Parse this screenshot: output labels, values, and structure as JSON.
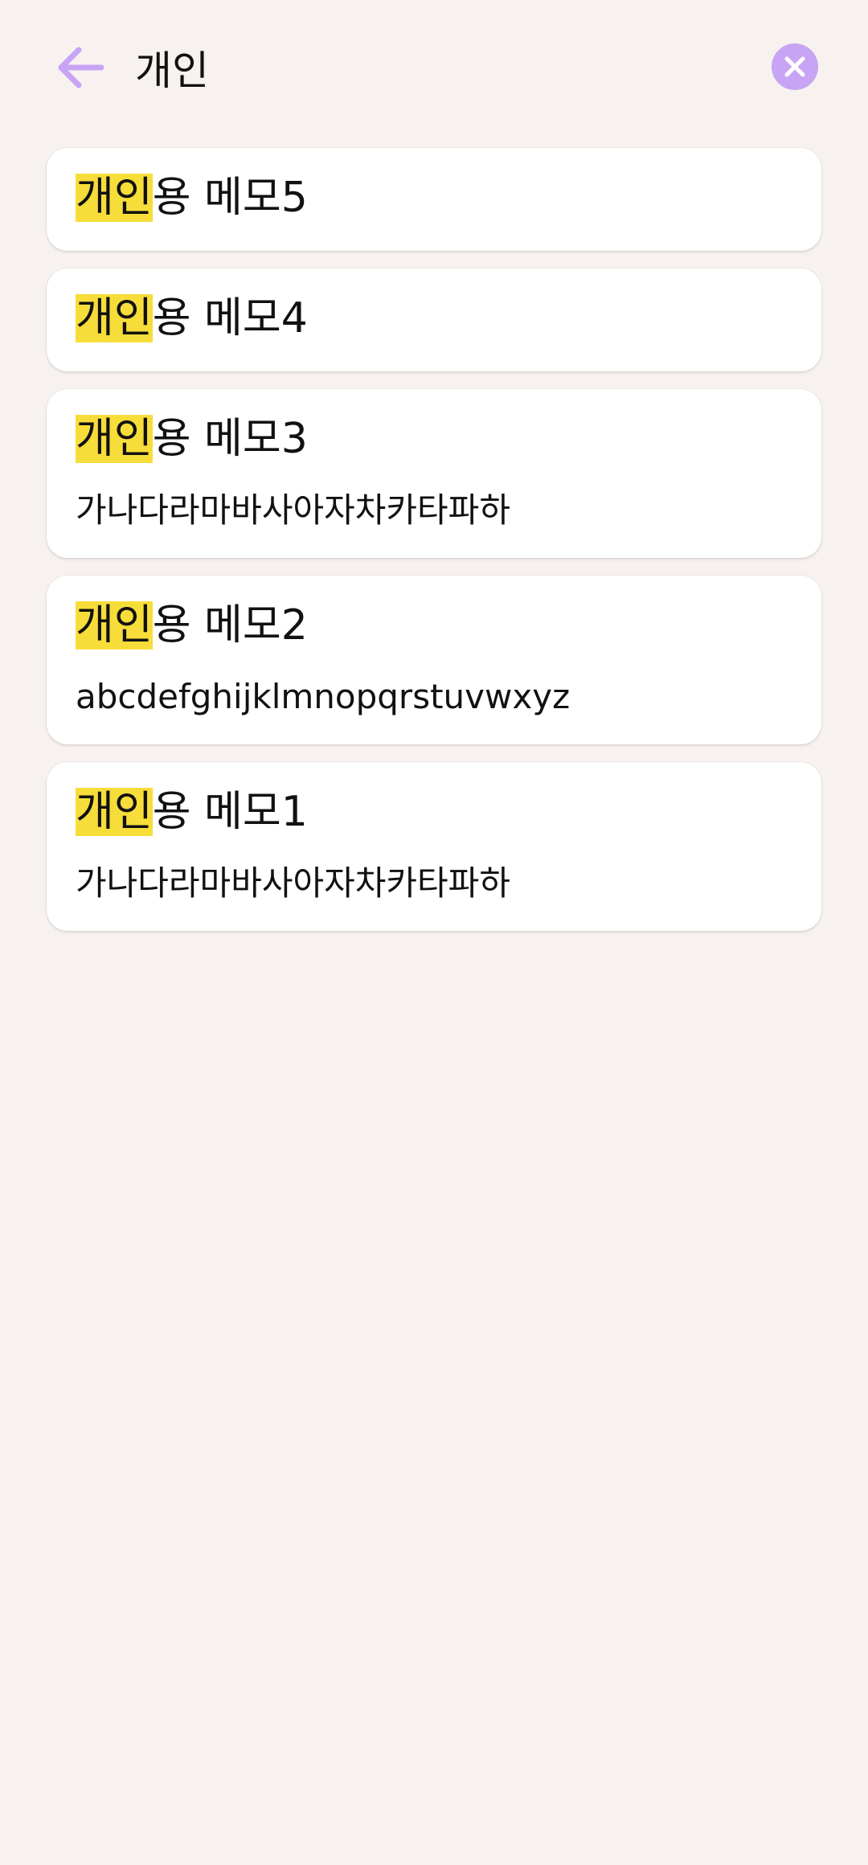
{
  "search": {
    "query": "개인"
  },
  "colors": {
    "background": "#f7f2ef",
    "accent": "#c8a4f5",
    "highlight": "#f7dd3a"
  },
  "icons": {
    "back": "arrow-left-icon",
    "clear": "close-icon"
  },
  "results": [
    {
      "title_match": "개인",
      "title_rest": "용 메모5",
      "body": ""
    },
    {
      "title_match": "개인",
      "title_rest": "용 메모4",
      "body": ""
    },
    {
      "title_match": "개인",
      "title_rest": "용 메모3",
      "body": "가나다라마바사아자차카타파하"
    },
    {
      "title_match": "개인",
      "title_rest": "용 메모2",
      "body": "abcdefghijklmnopqrstuvwxyz"
    },
    {
      "title_match": "개인",
      "title_rest": "용 메모1",
      "body": "가나다라마바사아자차카타파하"
    }
  ]
}
